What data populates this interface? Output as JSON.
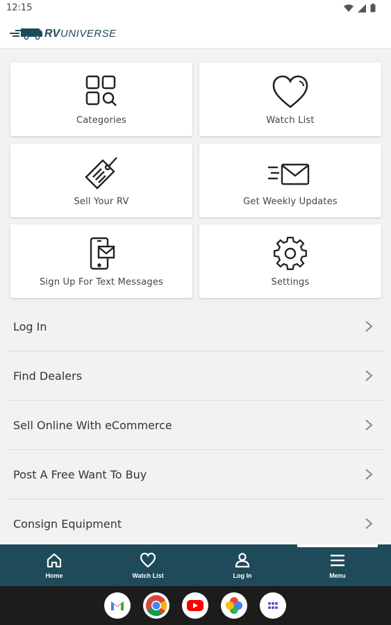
{
  "status_bar": {
    "time": "12:15"
  },
  "header": {
    "logo_text": "RV UNIVERSE"
  },
  "tiles": [
    {
      "label": "Categories",
      "icon": "categories-icon"
    },
    {
      "label": "Watch List",
      "icon": "heart-icon"
    },
    {
      "label": "Sell Your RV",
      "icon": "price-tag-icon"
    },
    {
      "label": "Get Weekly Updates",
      "icon": "envelope-icon"
    },
    {
      "label": "Sign Up For Text Messages",
      "icon": "phone-message-icon"
    },
    {
      "label": "Settings",
      "icon": "gear-icon"
    }
  ],
  "menu": [
    {
      "label": "Log In"
    },
    {
      "label": "Find Dealers"
    },
    {
      "label": "Sell Online With eCommerce"
    },
    {
      "label": "Post A Free Want To Buy"
    },
    {
      "label": "Consign Equipment"
    }
  ],
  "bottom_nav": [
    {
      "label": "Home",
      "icon": "home-icon"
    },
    {
      "label": "Watch List",
      "icon": "heart-icon"
    },
    {
      "label": "Log In",
      "icon": "user-icon"
    },
    {
      "label": "Menu",
      "icon": "menu-icon",
      "active": true
    }
  ],
  "dock": [
    "gmail-icon",
    "chrome-icon",
    "youtube-icon",
    "photos-icon",
    "app-drawer-icon"
  ],
  "colors": {
    "nav_bg": "#1f4a5a",
    "page_bg": "#f2f2f2",
    "logo": "#1f4a5a"
  }
}
